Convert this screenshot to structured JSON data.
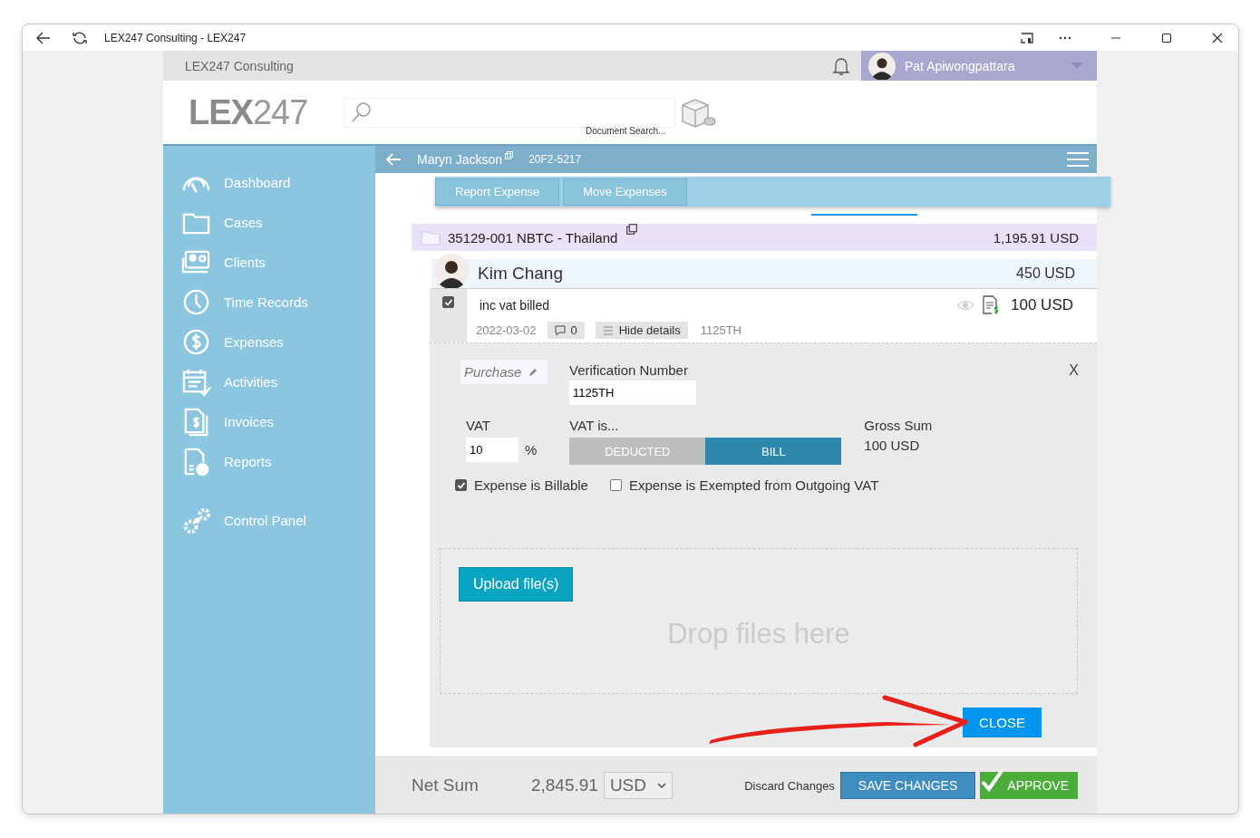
{
  "window": {
    "title": "LEX247 Consulting - LEX247"
  },
  "topbar": {
    "company": "LEX247 Consulting",
    "user": "Pat Apiwongpattara"
  },
  "header": {
    "logo_main": "LEX",
    "logo_suffix": "247",
    "search_caption": "Document Search..."
  },
  "sidebar": {
    "items": [
      {
        "label": "Dashboard",
        "kind": "gauge"
      },
      {
        "label": "Cases",
        "kind": "folder"
      },
      {
        "label": "Clients",
        "kind": "contact"
      },
      {
        "label": "Time Records",
        "kind": "clock"
      },
      {
        "label": "Expenses",
        "kind": "coin"
      },
      {
        "label": "Activities",
        "kind": "calendar"
      },
      {
        "label": "Invoices",
        "kind": "invoice"
      },
      {
        "label": "Reports",
        "kind": "report"
      },
      {
        "label": "Control Panel",
        "kind": "gears"
      }
    ]
  },
  "matter_bar": {
    "client": "Maryn Jackson",
    "code": "20F2-5217"
  },
  "menu": {
    "buttons": [
      "Report Expense",
      "Move Expenses"
    ]
  },
  "case_row": {
    "title": "35129-001 NBTC - Thailand",
    "amount": "1,195.91 USD"
  },
  "person_row": {
    "name": "Kim Chang",
    "amount": "450 USD"
  },
  "expense": {
    "checked": true,
    "description": "inc vat billed",
    "amount": "100 USD",
    "date": "2022-03-02",
    "comments": "0",
    "toggle": "Hide details",
    "reference": "1125TH"
  },
  "details": {
    "category": "Purchase",
    "verification_label": "Verification Number",
    "verification_value": "1125TH",
    "close_x": "X",
    "vat_label": "VAT",
    "vat_value": "10",
    "vat_unit": "%",
    "vat_is_label": "VAT is...",
    "vat_options": [
      {
        "label": "DEDUCTED",
        "selected": false
      },
      {
        "label": "BILL",
        "selected": true
      }
    ],
    "gross_label": "Gross Sum",
    "gross_value": "100 USD",
    "checkboxes": [
      {
        "label": "Expense is Billable",
        "checked": true
      },
      {
        "label": "Expense is Exempted from Outgoing VAT",
        "checked": false
      }
    ],
    "upload_button": "Upload file(s)",
    "drop_hint": "Drop files here",
    "close_button": "CLOSE"
  },
  "footer": {
    "net_label": "Net Sum",
    "net_value": "2,845.91",
    "currency": "USD",
    "discard": "Discard Changes",
    "save": "SAVE CHANGES",
    "approve": "APPROVE"
  }
}
